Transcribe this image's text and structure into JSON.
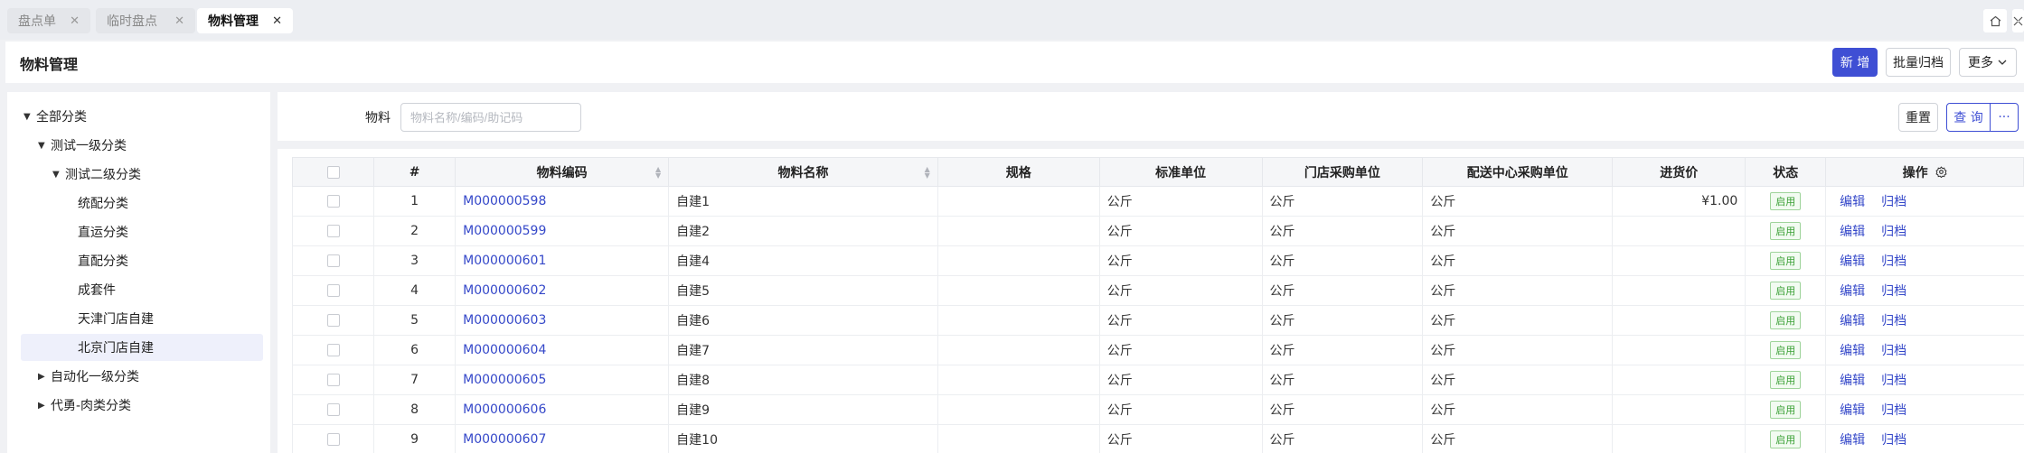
{
  "tabs": [
    {
      "label": "盘点单"
    },
    {
      "label": "临时盘点"
    },
    {
      "label": "物料管理"
    }
  ],
  "tab_close_glyph": "✕",
  "window_buttons": {
    "home_icon": "home-icon",
    "collapse_icon": "collapse-icon"
  },
  "header": {
    "title": "物料管理",
    "new_label": "新 增",
    "batch_archive_label": "批量归档",
    "more_label": "更多"
  },
  "tree": {
    "root": "全部分类",
    "level1_test": "测试一级分类",
    "level2_test": "测试二级分类",
    "children": [
      "统配分类",
      "直运分类",
      "直配分类",
      "成套件",
      "天津门店自建",
      "北京门店自建"
    ],
    "selected": "北京门店自建",
    "auto_level1": "自动化一级分类",
    "meat": "代勇-肉类分类"
  },
  "filter": {
    "label": "物料",
    "placeholder": "物料名称/编码/助记码",
    "reset_label": "重置",
    "query_label": "查 询",
    "more_glyph": "···"
  },
  "table": {
    "headers": {
      "index": "#",
      "code": "物料编码",
      "name": "物料名称",
      "spec": "规格",
      "unit": "标准单位",
      "store_unit": "门店采购单位",
      "dc_unit": "配送中心采购单位",
      "price": "进货价",
      "status": "状态",
      "ops": "操作"
    },
    "edit_label": "编辑",
    "archive_label": "归档",
    "rows": [
      {
        "index": "1",
        "code": "M000000598",
        "name": "自建1",
        "spec": "",
        "unit": "公斤",
        "store_unit": "公斤",
        "dc_unit": "公斤",
        "price": "¥1.00",
        "status": "启用"
      },
      {
        "index": "2",
        "code": "M000000599",
        "name": "自建2",
        "spec": "",
        "unit": "公斤",
        "store_unit": "公斤",
        "dc_unit": "公斤",
        "price": "",
        "status": "启用"
      },
      {
        "index": "3",
        "code": "M000000601",
        "name": "自建4",
        "spec": "",
        "unit": "公斤",
        "store_unit": "公斤",
        "dc_unit": "公斤",
        "price": "",
        "status": "启用"
      },
      {
        "index": "4",
        "code": "M000000602",
        "name": "自建5",
        "spec": "",
        "unit": "公斤",
        "store_unit": "公斤",
        "dc_unit": "公斤",
        "price": "",
        "status": "启用"
      },
      {
        "index": "5",
        "code": "M000000603",
        "name": "自建6",
        "spec": "",
        "unit": "公斤",
        "store_unit": "公斤",
        "dc_unit": "公斤",
        "price": "",
        "status": "启用"
      },
      {
        "index": "6",
        "code": "M000000604",
        "name": "自建7",
        "spec": "",
        "unit": "公斤",
        "store_unit": "公斤",
        "dc_unit": "公斤",
        "price": "",
        "status": "启用"
      },
      {
        "index": "7",
        "code": "M000000605",
        "name": "自建8",
        "spec": "",
        "unit": "公斤",
        "store_unit": "公斤",
        "dc_unit": "公斤",
        "price": "",
        "status": "启用"
      },
      {
        "index": "8",
        "code": "M000000606",
        "name": "自建9",
        "spec": "",
        "unit": "公斤",
        "store_unit": "公斤",
        "dc_unit": "公斤",
        "price": "",
        "status": "启用"
      },
      {
        "index": "9",
        "code": "M000000607",
        "name": "自建10",
        "spec": "",
        "unit": "公斤",
        "store_unit": "公斤",
        "dc_unit": "公斤",
        "price": "",
        "status": "启用"
      }
    ]
  },
  "colors": {
    "primary": "#3f4fd4",
    "link": "#3548c9",
    "status_green": "#3aa035"
  }
}
